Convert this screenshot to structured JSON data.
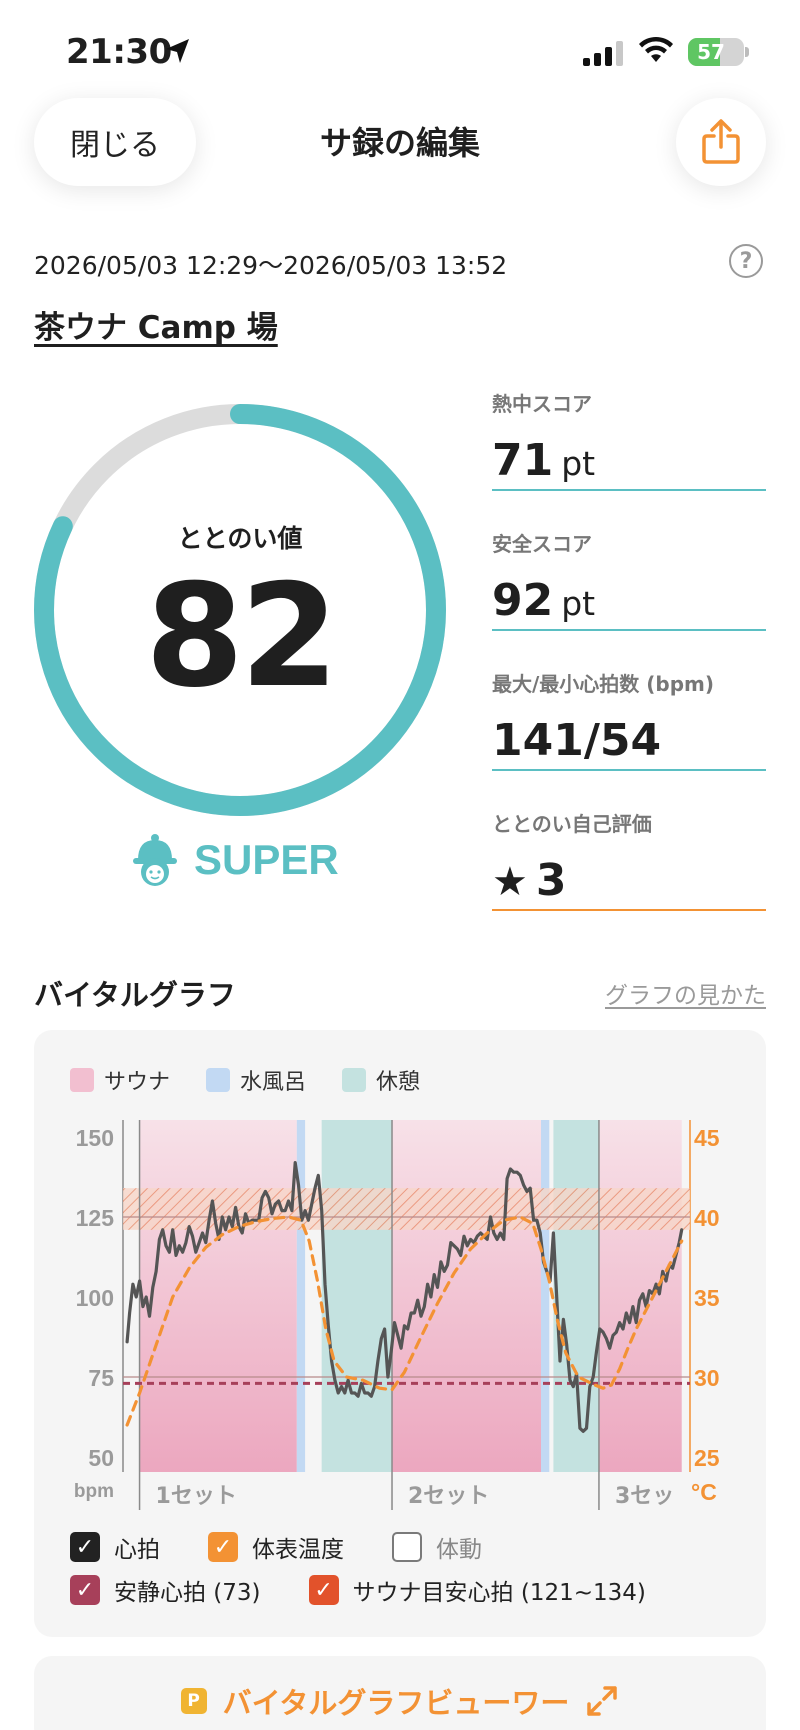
{
  "status_bar": {
    "time": "21:30",
    "battery": "57",
    "battery_level": 0.57
  },
  "header": {
    "close_label": "閉じる",
    "title": "サ録の編集"
  },
  "session": {
    "date_range": "2026/05/03 12:29～2026/05/03 13:52",
    "place": "茶ウナ Camp 場",
    "help": "?"
  },
  "score": {
    "label": "ととのい値",
    "value": "82",
    "value_num": 82,
    "max": 100,
    "rank": "SUPER"
  },
  "stats": [
    {
      "label": "熱中スコア",
      "value": "71",
      "unit": "pt"
    },
    {
      "label": "安全スコア",
      "value": "92",
      "unit": "pt"
    },
    {
      "label": "最大/最小心拍数 (bpm)",
      "value": "141/54",
      "unit": ""
    },
    {
      "label": "ととのい自己評価",
      "value": "3",
      "unit": ""
    }
  ],
  "vital": {
    "title": "バイタルグラフ",
    "link": "グラフの見かた"
  },
  "legend_top": [
    {
      "label": "サウナ",
      "color": "#f2bfd0"
    },
    {
      "label": "水風呂",
      "color": "#c2d9f3"
    },
    {
      "label": "休憩",
      "color": "#c4e2e0"
    }
  ],
  "chart_data": {
    "type": "line",
    "y_left_label": "bpm",
    "y_left_ticks": [
      "150",
      "125",
      "100",
      "75",
      "50"
    ],
    "y_left_range": [
      50,
      150
    ],
    "y_right_label": "°C",
    "y_right_ticks": [
      "45",
      "40",
      "35",
      "30",
      "25"
    ],
    "y_right_range": [
      25,
      45
    ],
    "set_labels": [
      "1セット",
      "2セット",
      "3セッ"
    ],
    "phases": [
      {
        "type": "sauna",
        "start": 0,
        "end": 19
      },
      {
        "type": "cold",
        "start": 19,
        "end": 20
      },
      {
        "type": "rest",
        "start": 22,
        "end": 30.5
      },
      {
        "type": "sauna",
        "start": 30.5,
        "end": 48.5
      },
      {
        "type": "cold",
        "start": 48.5,
        "end": 49.5
      },
      {
        "type": "rest",
        "start": 50,
        "end": 55.5
      },
      {
        "type": "sauna",
        "start": 55.5,
        "end": 65.5
      }
    ],
    "set_boundaries": [
      0,
      30.5,
      55.5
    ],
    "resting_hr": 73,
    "target_hr_range": [
      121,
      134
    ],
    "series": [
      {
        "name": "心拍",
        "axis": "left",
        "color": "#555555",
        "points": [
          [
            -1.5,
            86
          ],
          [
            -1.2,
            95
          ],
          [
            -0.8,
            104
          ],
          [
            -0.4,
            100
          ],
          [
            0,
            105
          ],
          [
            0.4,
            97
          ],
          [
            0.8,
            100
          ],
          [
            1.2,
            94
          ],
          [
            1.6,
            103
          ],
          [
            2,
            108
          ],
          [
            2.4,
            118
          ],
          [
            2.8,
            121
          ],
          [
            3.2,
            116
          ],
          [
            3.6,
            114
          ],
          [
            4,
            121
          ],
          [
            4.4,
            113
          ],
          [
            4.8,
            116
          ],
          [
            5.2,
            114
          ],
          [
            5.6,
            117
          ],
          [
            6,
            122
          ],
          [
            6.4,
            119
          ],
          [
            6.8,
            114
          ],
          [
            7.2,
            117
          ],
          [
            7.6,
            120
          ],
          [
            8,
            117
          ],
          [
            8.4,
            124
          ],
          [
            8.8,
            130
          ],
          [
            9.2,
            123
          ],
          [
            9.6,
            118
          ],
          [
            10,
            125
          ],
          [
            10.4,
            121
          ],
          [
            10.8,
            125
          ],
          [
            11.2,
            122
          ],
          [
            11.6,
            128
          ],
          [
            12,
            122
          ],
          [
            12.4,
            120
          ],
          [
            12.8,
            126
          ],
          [
            13.2,
            123
          ],
          [
            13.6,
            124
          ],
          [
            14,
            124
          ],
          [
            14.4,
            124
          ],
          [
            14.8,
            131
          ],
          [
            15.2,
            133
          ],
          [
            15.6,
            131
          ],
          [
            16,
            126
          ],
          [
            16.4,
            129
          ],
          [
            16.8,
            130
          ],
          [
            17.2,
            127
          ],
          [
            17.6,
            127
          ],
          [
            18,
            130
          ],
          [
            18.4,
            127
          ],
          [
            18.8,
            142
          ],
          [
            19.2,
            135
          ],
          [
            19.6,
            124
          ],
          [
            20,
            127
          ],
          [
            20.4,
            124
          ],
          [
            20.8,
            129
          ],
          [
            21.2,
            134
          ],
          [
            21.6,
            138
          ],
          [
            22,
            127
          ],
          [
            22.4,
            104
          ],
          [
            22.8,
            91
          ],
          [
            23.2,
            80
          ],
          [
            23.6,
            74
          ],
          [
            24,
            70
          ],
          [
            24.4,
            72
          ],
          [
            24.8,
            70
          ],
          [
            25.2,
            74
          ],
          [
            25.6,
            70
          ],
          [
            26,
            70
          ],
          [
            26.4,
            69
          ],
          [
            26.8,
            73
          ],
          [
            27.2,
            70
          ],
          [
            27.6,
            70
          ],
          [
            28,
            69
          ],
          [
            28.4,
            72
          ],
          [
            28.8,
            80
          ],
          [
            29.2,
            87
          ],
          [
            29.6,
            90
          ],
          [
            30,
            75
          ],
          [
            30.4,
            83
          ],
          [
            30.8,
            92
          ],
          [
            31.2,
            88
          ],
          [
            31.6,
            84
          ],
          [
            32,
            91
          ],
          [
            32.4,
            90
          ],
          [
            32.8,
            95
          ],
          [
            33.2,
            95
          ],
          [
            33.6,
            99
          ],
          [
            34,
            94
          ],
          [
            34.4,
            97
          ],
          [
            34.8,
            104
          ],
          [
            35.2,
            100
          ],
          [
            35.6,
            107
          ],
          [
            36,
            103
          ],
          [
            36.4,
            111
          ],
          [
            36.8,
            108
          ],
          [
            37.2,
            110
          ],
          [
            37.6,
            117
          ],
          [
            38,
            116
          ],
          [
            38.4,
            115
          ],
          [
            38.8,
            113
          ],
          [
            39.2,
            119
          ],
          [
            39.6,
            116
          ],
          [
            40,
            118
          ],
          [
            40.4,
            117
          ],
          [
            40.8,
            119
          ],
          [
            41.2,
            120
          ],
          [
            41.6,
            119
          ],
          [
            42,
            118
          ],
          [
            42.4,
            125
          ],
          [
            42.8,
            120
          ],
          [
            43.2,
            118
          ],
          [
            43.6,
            120
          ],
          [
            44,
            118
          ],
          [
            44.4,
            137
          ],
          [
            44.8,
            140
          ],
          [
            45.2,
            139
          ],
          [
            45.6,
            139
          ],
          [
            46,
            138
          ],
          [
            46.4,
            135
          ],
          [
            46.8,
            133
          ],
          [
            47.2,
            134
          ],
          [
            47.6,
            124
          ],
          [
            48,
            124
          ],
          [
            48.4,
            120
          ],
          [
            48.8,
            111
          ],
          [
            49.2,
            108
          ],
          [
            49.6,
            105
          ],
          [
            50,
            120
          ],
          [
            50.4,
            100
          ],
          [
            50.8,
            80
          ],
          [
            51.2,
            93
          ],
          [
            51.6,
            85
          ],
          [
            52,
            74
          ],
          [
            52.4,
            72
          ],
          [
            52.8,
            76
          ],
          [
            53.2,
            59
          ],
          [
            53.6,
            58
          ],
          [
            54,
            59
          ],
          [
            54.4,
            72
          ],
          [
            54.8,
            75
          ],
          [
            55.2,
            83
          ],
          [
            55.6,
            90
          ],
          [
            56,
            89
          ],
          [
            56.4,
            87
          ],
          [
            56.8,
            84
          ],
          [
            57.2,
            88
          ],
          [
            57.6,
            89
          ],
          [
            58,
            92
          ],
          [
            58.4,
            90
          ],
          [
            58.8,
            95
          ],
          [
            59.2,
            92
          ],
          [
            59.6,
            97
          ],
          [
            60,
            92
          ],
          [
            60.4,
            99
          ],
          [
            60.8,
            101
          ],
          [
            61.2,
            97
          ],
          [
            61.6,
            102
          ],
          [
            62,
            101
          ],
          [
            62.4,
            104
          ],
          [
            62.8,
            101
          ],
          [
            63.2,
            108
          ],
          [
            63.6,
            105
          ],
          [
            64,
            110
          ],
          [
            64.4,
            109
          ],
          [
            64.8,
            113
          ],
          [
            65.2,
            117
          ],
          [
            65.5,
            121
          ]
        ]
      },
      {
        "name": "体表温度",
        "axis": "right",
        "color": "#f39234",
        "points": [
          [
            -1.5,
            27
          ],
          [
            0,
            29
          ],
          [
            2,
            32
          ],
          [
            4,
            35
          ],
          [
            6,
            36.8
          ],
          [
            8,
            38.1
          ],
          [
            10,
            38.9
          ],
          [
            12,
            39.4
          ],
          [
            14,
            39.7
          ],
          [
            16,
            39.9
          ],
          [
            18,
            40
          ],
          [
            19.5,
            39.8
          ],
          [
            20.5,
            38.5
          ],
          [
            21.5,
            36
          ],
          [
            22.5,
            33
          ],
          [
            23.5,
            31
          ],
          [
            25,
            30
          ],
          [
            27,
            29.8
          ],
          [
            29,
            29.3
          ],
          [
            30.5,
            29.2
          ],
          [
            32,
            30.3
          ],
          [
            34,
            32.5
          ],
          [
            36,
            34.6
          ],
          [
            38,
            36.5
          ],
          [
            40,
            38
          ],
          [
            42,
            39
          ],
          [
            44,
            39.8
          ],
          [
            46,
            40
          ],
          [
            47.5,
            39.6
          ],
          [
            48.5,
            38
          ],
          [
            49.5,
            36
          ],
          [
            50.5,
            33.5
          ],
          [
            51.5,
            31.5
          ],
          [
            53,
            30
          ],
          [
            55,
            29.5
          ],
          [
            56,
            29.3
          ],
          [
            57,
            29.5
          ],
          [
            58,
            30.5
          ],
          [
            59,
            31.8
          ],
          [
            60,
            33
          ],
          [
            61,
            34
          ],
          [
            62,
            35
          ],
          [
            63,
            36
          ],
          [
            64,
            37
          ],
          [
            65.5,
            38.5
          ]
        ]
      }
    ]
  },
  "checks": [
    {
      "label": "心拍",
      "checked": true,
      "color": "#222222"
    },
    {
      "label": "体表温度",
      "checked": true,
      "color": "#f39234"
    },
    {
      "label": "体動",
      "checked": false,
      "color": "#888888"
    },
    {
      "label": "安静心拍 (73)",
      "checked": true,
      "color": "#a7405a"
    },
    {
      "label": "サウナ目安心拍 (121~134)",
      "checked": true,
      "color": "#e2522b"
    }
  ],
  "viewer": {
    "badge": "P",
    "label": "バイタルグラフビューワー"
  },
  "colors": {
    "teal": "#5bbfc3",
    "orange": "#f39234",
    "ring_track": "#dcdcdc"
  }
}
